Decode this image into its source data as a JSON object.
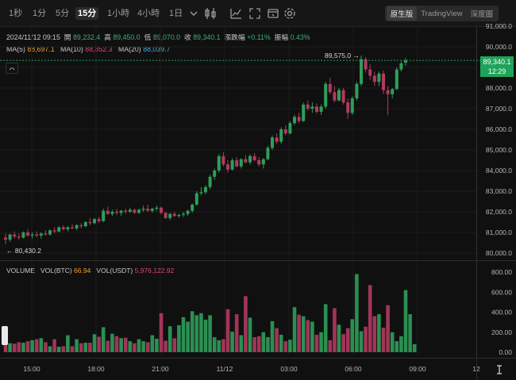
{
  "toolbar": {
    "timeframes": [
      "1秒",
      "1分",
      "5分",
      "15分",
      "1小時",
      "4小時",
      "1日"
    ],
    "active_timeframe": "15分",
    "dropdown_icon": "chevron-down-icon",
    "icons": [
      "candle-type-icon",
      "indicator-icon",
      "settings-window-icon",
      "fullscreen-icon",
      "gear-icon"
    ],
    "views": [
      "原生版",
      "TradingView",
      "深度圖"
    ],
    "active_view": "原生版"
  },
  "info": {
    "datetime": "2024/11/12 09:15",
    "open_label": "開",
    "open": "89,232.4",
    "high_label": "高",
    "high": "89,450.0",
    "low_label": "低",
    "low": "89,070.0",
    "close_label": "收",
    "close": "89,340.1",
    "change_label": "漲跌幅",
    "change": "+0.11%",
    "amplitude_label": "振幅",
    "amplitude": "0.43%",
    "ma5_label": "MA(5)",
    "ma5": "88,697.1",
    "ma10_label": "MA(10)",
    "ma10": "88,852.3",
    "ma20_label": "MA(20)",
    "ma20": "88,039.7"
  },
  "volume_info": {
    "label": "VOLUME",
    "btc_label": "VOL(BTC)",
    "btc": "66.94",
    "usdt_label": "VOL(USDT)",
    "usdt": "5,976,122.92"
  },
  "price_tag": {
    "price": "89,340.1",
    "countdown": "12:29"
  },
  "annotations": {
    "high": "89,575.0 →",
    "low": "← 80,430.2"
  },
  "colors": {
    "up": "#2e9e5a",
    "down": "#b23a60",
    "ma_ref": "#3fb06e",
    "tag": "#1fa35a",
    "bg": "#101010"
  },
  "chart_data": [
    {
      "type": "candlestick",
      "ylim": [
        80000,
        91000
      ],
      "y_ticks": [
        "80,000.0",
        "81,000.0",
        "82,000.0",
        "83,000.0",
        "84,000.0",
        "85,000.0",
        "86,000.0",
        "87,000.0",
        "88,000.0",
        "89,000.0",
        "90,000.0",
        "91,000.0"
      ],
      "x_ticks": [
        "15:00",
        "18:00",
        "21:00",
        "11/12",
        "03:00",
        "06:00",
        "09:00",
        "12"
      ],
      "candles": [
        [
          80750,
          80950,
          80430,
          80650
        ],
        [
          80650,
          80950,
          80550,
          80900
        ],
        [
          80900,
          81050,
          80700,
          80800
        ],
        [
          80800,
          80950,
          80650,
          80750
        ],
        [
          80750,
          81050,
          80700,
          81000
        ],
        [
          81000,
          81150,
          80800,
          80850
        ],
        [
          80850,
          81000,
          80700,
          80900
        ],
        [
          80900,
          81050,
          80750,
          80850
        ],
        [
          80850,
          81000,
          80700,
          80950
        ],
        [
          80950,
          81100,
          80850,
          80900
        ],
        [
          80900,
          81150,
          80850,
          81100
        ],
        [
          81100,
          81250,
          80950,
          81050
        ],
        [
          81050,
          81300,
          81000,
          81250
        ],
        [
          81250,
          81350,
          81100,
          81150
        ],
        [
          81150,
          81300,
          81050,
          81250
        ],
        [
          81250,
          81400,
          81150,
          81200
        ],
        [
          81200,
          81400,
          81100,
          81350
        ],
        [
          81350,
          81450,
          81200,
          81300
        ],
        [
          81300,
          81550,
          81250,
          81500
        ],
        [
          81500,
          81700,
          81350,
          81450
        ],
        [
          81450,
          81700,
          81400,
          81650
        ],
        [
          81650,
          81750,
          81450,
          81550
        ],
        [
          81550,
          82150,
          81500,
          82050
        ],
        [
          82050,
          82250,
          81850,
          81900
        ],
        [
          81900,
          82100,
          81800,
          82000
        ],
        [
          82000,
          82150,
          81850,
          81950
        ],
        [
          81950,
          82100,
          81800,
          82050
        ],
        [
          82050,
          82150,
          81900,
          82000
        ],
        [
          82000,
          82200,
          81950,
          82100
        ],
        [
          82100,
          82150,
          81900,
          81950
        ],
        [
          81950,
          82150,
          81900,
          82100
        ],
        [
          82100,
          82300,
          82000,
          82150
        ],
        [
          82150,
          82350,
          82000,
          82050
        ],
        [
          82050,
          82200,
          81950,
          82150
        ],
        [
          82150,
          82300,
          82050,
          82200
        ],
        [
          82200,
          82250,
          81900,
          81950
        ],
        [
          81950,
          82000,
          81650,
          81700
        ],
        [
          81700,
          81950,
          81600,
          81900
        ],
        [
          81900,
          82000,
          81750,
          81800
        ],
        [
          81800,
          81900,
          81700,
          81850
        ],
        [
          81850,
          82000,
          81750,
          81900
        ],
        [
          81900,
          82100,
          81800,
          82050
        ],
        [
          82050,
          82400,
          81950,
          82350
        ],
        [
          82350,
          83000,
          82300,
          82900
        ],
        [
          82900,
          83200,
          82800,
          82950
        ],
        [
          82950,
          83300,
          82850,
          83200
        ],
        [
          83200,
          83800,
          83100,
          83700
        ],
        [
          83700,
          84100,
          83550,
          84000
        ],
        [
          84000,
          84800,
          83900,
          84700
        ],
        [
          84700,
          84900,
          84200,
          84300
        ],
        [
          84300,
          84500,
          83900,
          84050
        ],
        [
          84050,
          84600,
          84000,
          84500
        ],
        [
          84500,
          84650,
          84150,
          84200
        ],
        [
          84200,
          84600,
          84100,
          84550
        ],
        [
          84550,
          84750,
          84350,
          84400
        ],
        [
          84400,
          84800,
          84300,
          84700
        ],
        [
          84700,
          84850,
          84450,
          84500
        ],
        [
          84500,
          84650,
          84200,
          84300
        ],
        [
          84300,
          84600,
          84100,
          84550
        ],
        [
          84550,
          85200,
          84500,
          85100
        ],
        [
          85100,
          85700,
          85000,
          85600
        ],
        [
          85600,
          85800,
          85300,
          85400
        ],
        [
          85400,
          86100,
          85300,
          86000
        ],
        [
          86000,
          86200,
          85700,
          85800
        ],
        [
          85800,
          86400,
          85750,
          86300
        ],
        [
          86300,
          86700,
          86200,
          86600
        ],
        [
          86600,
          86800,
          86300,
          86400
        ],
        [
          86400,
          87300,
          86350,
          87200
        ],
        [
          87200,
          87400,
          86900,
          87000
        ],
        [
          87000,
          87300,
          86800,
          87100
        ],
        [
          87100,
          87250,
          86750,
          86850
        ],
        [
          86850,
          87200,
          86700,
          87100
        ],
        [
          87100,
          88300,
          87000,
          88200
        ],
        [
          88200,
          88500,
          87700,
          87800
        ],
        [
          87800,
          88100,
          87300,
          87400
        ],
        [
          87400,
          88000,
          87350,
          87900
        ],
        [
          87900,
          88000,
          87200,
          87300
        ],
        [
          87300,
          87500,
          86500,
          86800
        ],
        [
          86800,
          87600,
          86700,
          87500
        ],
        [
          87500,
          88300,
          87400,
          88200
        ],
        [
          88200,
          89575,
          88100,
          89400
        ],
        [
          89400,
          89500,
          88750,
          88900
        ],
        [
          88900,
          89150,
          88400,
          88600
        ],
        [
          88600,
          88800,
          88100,
          88300
        ],
        [
          88300,
          88800,
          88100,
          88700
        ],
        [
          88700,
          88850,
          87700,
          87900
        ],
        [
          87900,
          88100,
          86700,
          87700
        ],
        [
          87700,
          88000,
          87500,
          87950
        ],
        [
          87950,
          89000,
          87900,
          88900
        ],
        [
          88900,
          89300,
          88800,
          89200
        ],
        [
          89232.4,
          89450,
          89070,
          89340.1
        ]
      ]
    },
    {
      "type": "bar",
      "name": "VOLUME",
      "ylim": [
        0,
        800
      ],
      "y_ticks": [
        "0.00",
        "200.00",
        "400.00",
        "600.00",
        "800.00"
      ],
      "values": [
        70,
        90,
        85,
        100,
        95,
        110,
        120,
        130,
        140,
        100,
        60,
        130,
        55,
        60,
        170,
        60,
        130,
        90,
        95,
        95,
        180,
        155,
        250,
        115,
        185,
        160,
        140,
        145,
        110,
        90,
        130,
        110,
        100,
        170,
        135,
        390,
        115,
        260,
        140,
        270,
        350,
        305,
        410,
        370,
        390,
        325,
        370,
        150,
        120,
        130,
        430,
        205,
        380,
        170,
        560,
        345,
        150,
        160,
        200,
        150,
        310,
        240,
        175,
        110,
        125,
        450,
        375,
        360,
        320,
        305,
        175,
        200,
        480,
        120,
        440,
        275,
        180,
        240,
        330,
        780,
        210,
        255,
        670,
        360,
        380,
        245,
        470,
        200,
        110,
        160,
        620,
        380,
        80
      ]
    }
  ]
}
